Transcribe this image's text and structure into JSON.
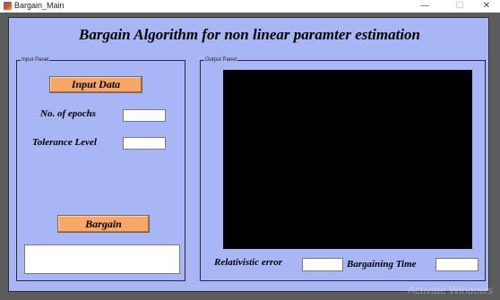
{
  "window": {
    "title": "Bargain_Main",
    "minimize_glyph": "—",
    "maximize_glyph": "☐",
    "close_glyph": "✕"
  },
  "header": {
    "title": "Bargain Algorithm for non linear paramter estimation"
  },
  "input_panel": {
    "label": "Input Panel",
    "input_data_button": "Input Data",
    "epochs_label": "No. of epochs",
    "tolerance_label": "Tolerance Level",
    "bargain_button": "Bargain",
    "epochs_value": "",
    "tolerance_value": ""
  },
  "output_panel": {
    "label": "Output Panel",
    "relativistic_error_label": "Relativistic error",
    "bargaining_time_label": "Bargaining Time",
    "relativistic_error_value": "",
    "bargaining_time_value": ""
  },
  "watermark": "Activate Windows",
  "colors": {
    "figure_background": "#a8b6f6",
    "button": "#f9a766",
    "plot_background": "#000000"
  }
}
